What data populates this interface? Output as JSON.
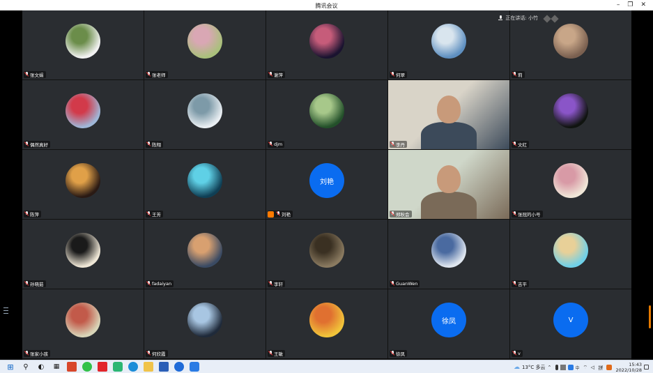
{
  "window": {
    "title": "腾讯会议"
  },
  "window_controls": {
    "minimize": "–",
    "restore": "❐",
    "close": "✕"
  },
  "speaking_indicator": "正在讲话: 小竹",
  "participants": [
    {
      "name": "张文娟",
      "kind": "photo",
      "colors": [
        "#f2f2f2",
        "#6b8d4a"
      ]
    },
    {
      "name": "张老师",
      "kind": "photo",
      "colors": [
        "#a9c07b",
        "#d9a7b4"
      ]
    },
    {
      "name": "谢萍",
      "kind": "photo",
      "colors": [
        "#1a1330",
        "#c65c7a"
      ]
    },
    {
      "name": "何翠",
      "kind": "photo",
      "colors": [
        "#5e8fc0",
        "#d9e5ee"
      ]
    },
    {
      "name": "莉",
      "kind": "photo",
      "colors": [
        "#7a6050",
        "#c8a688"
      ]
    },
    {
      "name": "偶然真好",
      "kind": "photo",
      "colors": [
        "#9fb7d8",
        "#d23a4a"
      ]
    },
    {
      "name": "陈翔",
      "kind": "photo",
      "colors": [
        "#e9eef2",
        "#7d9aa8"
      ]
    },
    {
      "name": "djm",
      "kind": "photo",
      "colors": [
        "#23502a",
        "#a7c88a"
      ]
    },
    {
      "name": "李丹",
      "kind": "video",
      "colors": [
        "#d9d4c8",
        "#3c4a5a"
      ]
    },
    {
      "name": "文红",
      "kind": "photo",
      "colors": [
        "#101410",
        "#8a55c8"
      ]
    },
    {
      "name": "陈萍",
      "kind": "photo",
      "colors": [
        "#2a1a14",
        "#e0a048"
      ]
    },
    {
      "name": "王芳",
      "kind": "photo",
      "colors": [
        "#0f3f55",
        "#5fd0e6"
      ]
    },
    {
      "name": "刘艳",
      "kind": "text",
      "label": "刘艳",
      "host": true
    },
    {
      "name": "郑秋会",
      "kind": "video",
      "colors": [
        "#cfd7c9",
        "#7a6a58"
      ]
    },
    {
      "name": "张冠的小号",
      "kind": "photo",
      "colors": [
        "#f0e6d8",
        "#d89aa6"
      ]
    },
    {
      "name": "孙晓茹",
      "kind": "photo",
      "colors": [
        "#efe7d6",
        "#1a1a1a"
      ]
    },
    {
      "name": "fadaiyan",
      "kind": "photo",
      "colors": [
        "#3a4a63",
        "#d8a070"
      ]
    },
    {
      "name": "李轩",
      "kind": "photo",
      "colors": [
        "#8a7a60",
        "#3a3022"
      ]
    },
    {
      "name": "GuanWen",
      "kind": "photo",
      "colors": [
        "#dfe6ef",
        "#4a6aa0"
      ]
    },
    {
      "name": "吉平",
      "kind": "photo",
      "colors": [
        "#6fd0e8",
        "#e8d098"
      ]
    },
    {
      "name": "张家小孩",
      "kind": "photo",
      "colors": [
        "#d8d5b8",
        "#c25a4a"
      ]
    },
    {
      "name": "何欣霞",
      "kind": "photo",
      "colors": [
        "#1f2a3a",
        "#a8c6e2"
      ]
    },
    {
      "name": "王敏",
      "kind": "photo",
      "colors": [
        "#f1c43a",
        "#e07030"
      ]
    },
    {
      "name": "徐凤",
      "kind": "text",
      "label": "徐凤"
    },
    {
      "name": "v",
      "kind": "text",
      "label": "V"
    }
  ],
  "taskbar": {
    "icons": [
      "windows-icon",
      "search-icon",
      "task-view-icon",
      "widgets-icon",
      "office-icon",
      "wechat-icon",
      "redbox-icon",
      "feishu-icon",
      "edge-icon",
      "explorer-icon",
      "word-icon",
      "wps-icon",
      "tencent-meeting-icon"
    ]
  },
  "tray": {
    "weather": "13°C 多云",
    "time": "15:43",
    "date": "2022/10/28"
  }
}
